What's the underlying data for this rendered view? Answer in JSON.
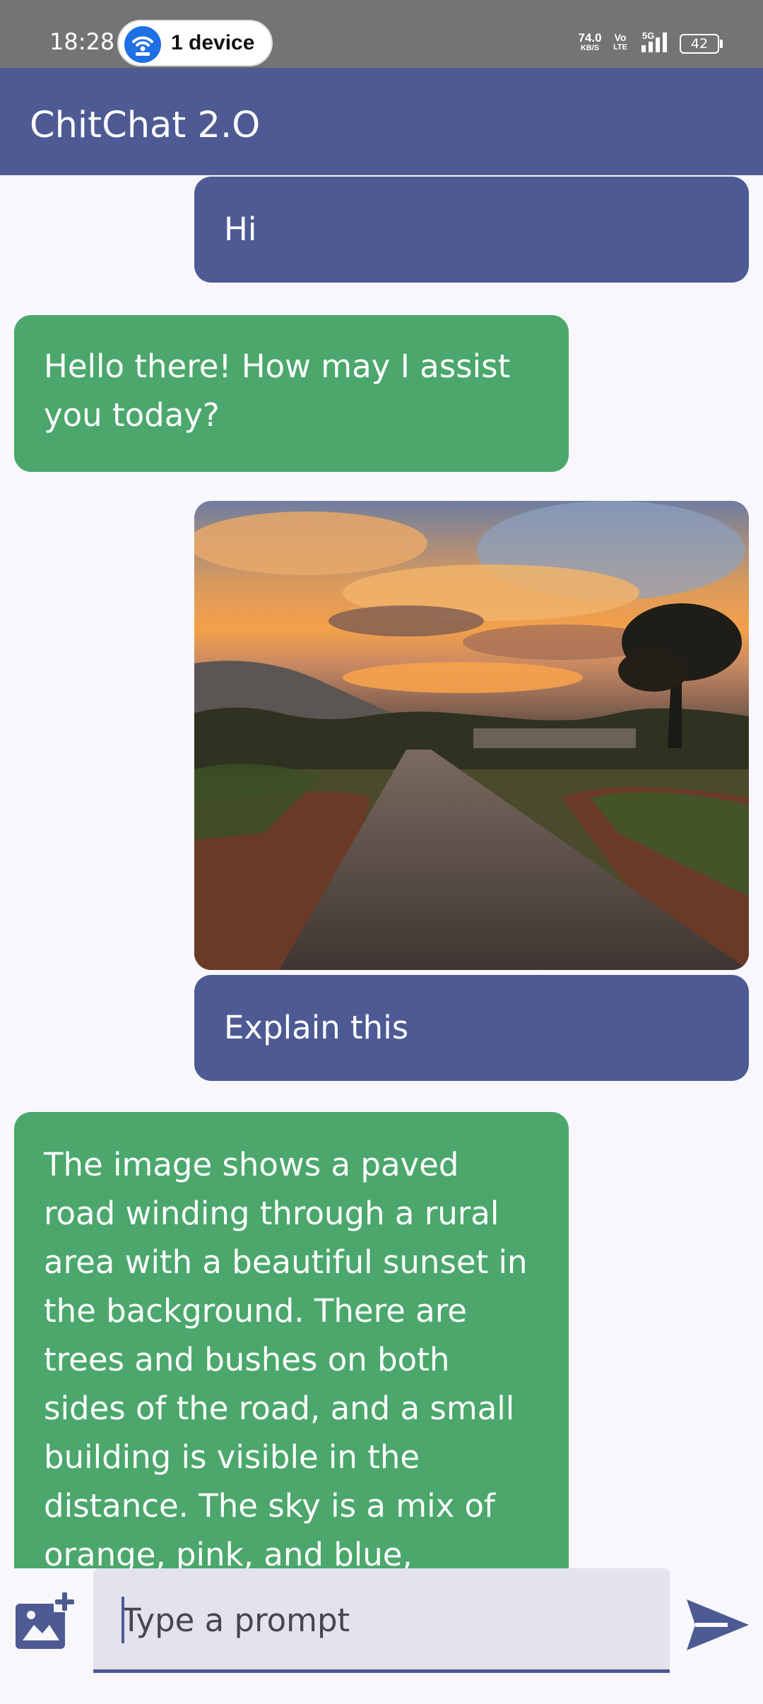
{
  "status_bar": {
    "time": "18:28",
    "device_pill": "1 device",
    "net_speed_value": "74.0",
    "net_speed_unit": "KB/S",
    "volte_top": "Vo",
    "volte_bottom": "LTE",
    "network": "5G",
    "battery": "42"
  },
  "app_bar": {
    "title": "ChitChat 2.O"
  },
  "messages": [
    {
      "role": "user",
      "text": "Hi"
    },
    {
      "role": "bot",
      "text": "Hello there! How may I assist you today?"
    },
    {
      "role": "user",
      "image": "sunset-road-photo"
    },
    {
      "role": "user",
      "text": "Explain this"
    },
    {
      "role": "bot",
      "text": "The image shows a paved road winding through a rural area with a beautiful sunset in the background. There are trees and bushes on both sides of the road, and a small building is visible in the distance. The sky is a mix of orange, pink, and blue, creating a stunning"
    }
  ],
  "input": {
    "placeholder": "Type a prompt"
  },
  "icons": {
    "add_image": "add-image-icon",
    "send": "send-icon"
  },
  "colors": {
    "primary": "#4e5a93",
    "bot_bubble": "#4ba76c",
    "background": "#f7f7fc",
    "field": "#e3e2ed"
  }
}
